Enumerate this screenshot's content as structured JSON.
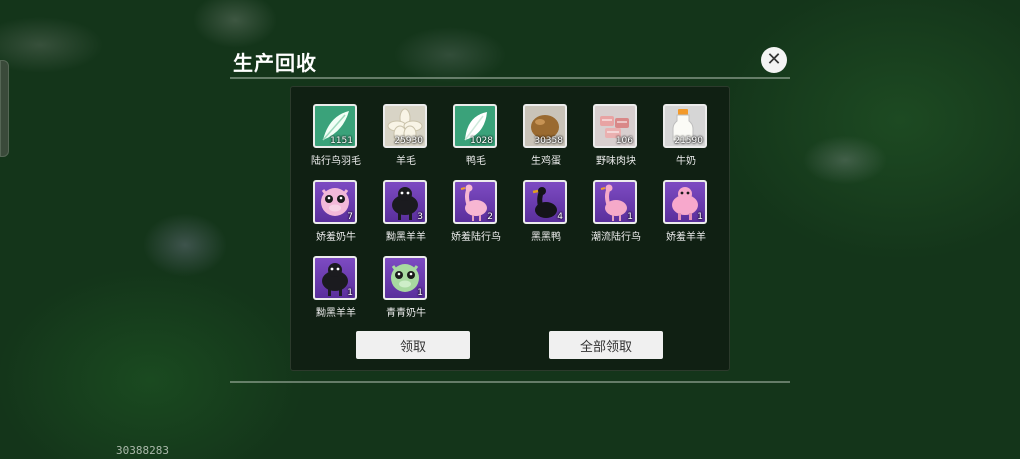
{
  "dialog": {
    "title": "生产回收",
    "close_label": "✕"
  },
  "items": [
    {
      "name": "陆行鸟羽毛",
      "count": "1151",
      "icon": "green-feather-icon",
      "kind": "item"
    },
    {
      "name": "羊毛",
      "count": "25930",
      "icon": "wool-icon",
      "kind": "item"
    },
    {
      "name": "鸭毛",
      "count": "1028",
      "icon": "duck-feather-icon",
      "kind": "item"
    },
    {
      "name": "生鸡蛋",
      "count": "30358",
      "icon": "egg-icon",
      "kind": "item"
    },
    {
      "name": "野味肉块",
      "count": "106",
      "icon": "meat-icon",
      "kind": "item"
    },
    {
      "name": "牛奶",
      "count": "21590",
      "icon": "milk-icon",
      "kind": "item"
    },
    {
      "name": "娇羞奶牛",
      "count": "7",
      "icon": "pink-cow-icon",
      "kind": "pet"
    },
    {
      "name": "黝黑羊羊",
      "count": "3",
      "icon": "black-sheep-icon",
      "kind": "pet"
    },
    {
      "name": "娇羞陆行鸟",
      "count": "2",
      "icon": "pink-ostrich-icon",
      "kind": "pet"
    },
    {
      "name": "黑黑鸭",
      "count": "4",
      "icon": "black-duck-icon",
      "kind": "pet"
    },
    {
      "name": "潮流陆行鸟",
      "count": "1",
      "icon": "pink-ostrich-icon",
      "kind": "pet"
    },
    {
      "name": "娇羞羊羊",
      "count": "1",
      "icon": "pink-sheep-icon",
      "kind": "pet"
    },
    {
      "name": "黝黑羊羊",
      "count": "1",
      "icon": "black-sheep-icon",
      "kind": "pet"
    },
    {
      "name": "青青奶牛",
      "count": "1",
      "icon": "green-cow-icon",
      "kind": "pet"
    }
  ],
  "buttons": {
    "claim": "领取",
    "claim_all": "全部领取"
  },
  "player_uid": "30388283"
}
